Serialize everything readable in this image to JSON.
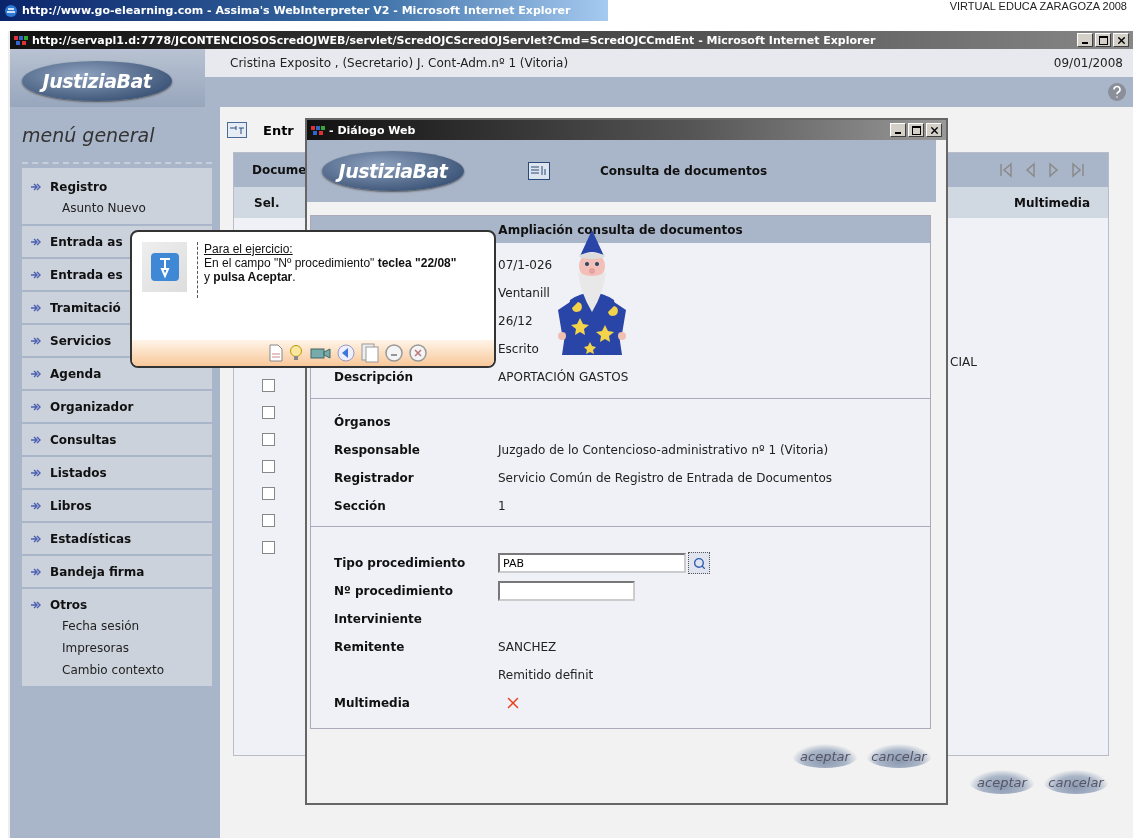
{
  "browser": {
    "outer_title": "http://www.go-elearning.com - Assima's WebInterpreter V2 - Microsoft Internet Explorer",
    "corner_text": "VIRTUAL EDUCA ZARAGOZA 2008",
    "inner_title": "http://servapl1.d:7778/JCONTENCIOSOScredOJWEB/servlet/ScredOJCScredOJServlet?Cmd=ScredOJCCmdEnt - Microsoft Internet Explorer"
  },
  "header": {
    "logo": "JustiziaBat",
    "user": "Cristina Exposito , (Secretario) J. Cont-Adm.nº 1 (Vitoria)",
    "date": "09/01/2008"
  },
  "sidebar": {
    "title": "menú general",
    "groups": [
      {
        "label": "Registro",
        "children": [
          "Asunto Nuevo"
        ]
      },
      {
        "label": "Entrada as"
      },
      {
        "label": "Entrada es"
      },
      {
        "label": "Tramitació"
      },
      {
        "label": "Servicios"
      },
      {
        "label": "Agenda"
      },
      {
        "label": "Organizador"
      },
      {
        "label": "Consultas"
      },
      {
        "label": "Listados"
      },
      {
        "label": "Libros"
      },
      {
        "label": "Estadísticas"
      },
      {
        "label": "Bandeja firma"
      },
      {
        "label": "Otros",
        "children": [
          "Fecha sesión",
          "Impresoras",
          "Cambio contexto"
        ]
      }
    ]
  },
  "content": {
    "title": "Entr",
    "table": {
      "header": "Docume",
      "columns": [
        "Sel.",
        "Multimedia"
      ],
      "rows": [
        {
          "kind": "text",
          "column_3": "CIAL"
        },
        {
          "kind": "checkbox",
          "checked": false
        },
        {
          "kind": "checkbox",
          "checked": false
        },
        {
          "kind": "checkbox",
          "checked": false
        },
        {
          "kind": "checkbox",
          "checked": false
        },
        {
          "kind": "checkbox",
          "checked": false
        },
        {
          "kind": "checkbox",
          "checked": false
        },
        {
          "kind": "checkbox",
          "checked": false
        }
      ]
    },
    "buttons": [
      "aceptar",
      "cancelar"
    ]
  },
  "dialog": {
    "title": "- Diálogo Web",
    "logo": "JustiziaBat",
    "heading": "Consulta de documentos",
    "panel_title": "Ampliación consulta de documentos",
    "sections": [
      {
        "rows": [
          {
            "kind": "text",
            "value": "07/1-026"
          },
          {
            "kind": "text",
            "value": "Ventanill"
          },
          {
            "kind": "text",
            "value": "26/12"
          },
          {
            "kind": "text",
            "value": "Escrito"
          },
          {
            "kind": "text",
            "label": "Descripción",
            "value": "APORTACIÓN GASTOS"
          }
        ]
      },
      {
        "rows": [
          {
            "kind": "label",
            "label": "Órganos"
          },
          {
            "kind": "text",
            "label": "Responsable",
            "value": "Juzgado de lo Contencioso-administrativo nº 1 (Vitoria)"
          },
          {
            "kind": "text",
            "label": "Registrador",
            "value": "Servicio Común de Registro de Entrada de Documentos"
          },
          {
            "kind": "text",
            "label": "Sección",
            "value": "1"
          }
        ]
      },
      {
        "rows": [
          {
            "kind": "lookup",
            "label": "Tipo procedimiento",
            "value": "PAB"
          },
          {
            "kind": "field",
            "label": "Nº procedimiento"
          },
          {
            "kind": "label",
            "label": "Interviniente"
          },
          {
            "kind": "text",
            "label": "Remitente",
            "value": "SANCHEZ"
          },
          {
            "kind": "text",
            "value": "Remitido definit"
          },
          {
            "kind": "none-mark",
            "label": "Multimedia"
          }
        ]
      }
    ],
    "buttons": [
      "aceptar",
      "cancelar"
    ]
  },
  "tooltip": {
    "heading": "Para el ejercicio:",
    "text": "En el campo \"Nº procedimiento\" **teclea \"22/08\"** y **pulsa Aceptar**."
  }
}
